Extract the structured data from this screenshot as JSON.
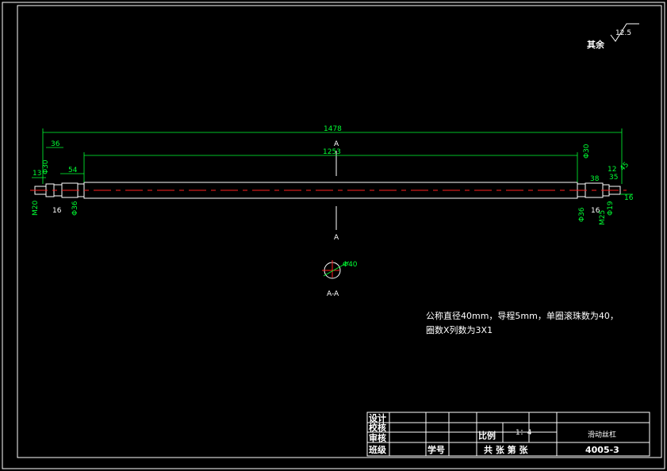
{
  "roughness": {
    "value": "12.5",
    "other": "其余"
  },
  "dimensions": {
    "overall_length": "1478",
    "middle_length": "1253",
    "left_dia_small": "Φ30",
    "left_len_36": "36",
    "left_len_13": "13",
    "left_len_54": "54",
    "left_len_16": "16",
    "left_thread": "M20",
    "left_dia_36": "Φ36",
    "right_dia_30": "Φ30",
    "right_len_38": "38",
    "right_len_12": "12",
    "right_len_35": "35",
    "right_len_45": "45",
    "right_len_16a": "16",
    "right_len_16b": "16",
    "right_dia_36": "Φ36",
    "right_thread": "M25",
    "right_dia_19": "Φ19"
  },
  "section": {
    "cut_label": "A",
    "name": "A-A",
    "diameter": "Φ40"
  },
  "notes": {
    "line1": "公称直径40mm，导程5mm，单圈滚珠数为40，",
    "line2": "圈数X列数为3X1"
  },
  "title_block": {
    "design": "设计",
    "proofread": "校核",
    "review": "审核",
    "class": "班级",
    "student_id": "学号",
    "scale_label": "比例",
    "scale_value": "1：4",
    "part_name": "滑动丝杠",
    "sheets": "共 张  第 张",
    "drawing_no": "4005-3"
  }
}
